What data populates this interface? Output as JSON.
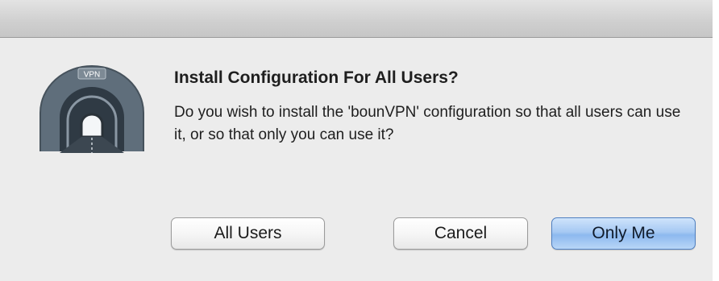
{
  "dialog": {
    "title": "Install Configuration For All Users?",
    "message": "Do you wish to install the 'bounVPN' configuration so that all users can use it, or so that only you can use it?",
    "icon": {
      "name": "vpn-tunnel-icon",
      "label": "VPN"
    },
    "buttons": {
      "all_users": "All Users",
      "cancel": "Cancel",
      "only_me": "Only Me"
    },
    "colors": {
      "default_button": "#a6c9f3",
      "background": "#ececec"
    }
  }
}
